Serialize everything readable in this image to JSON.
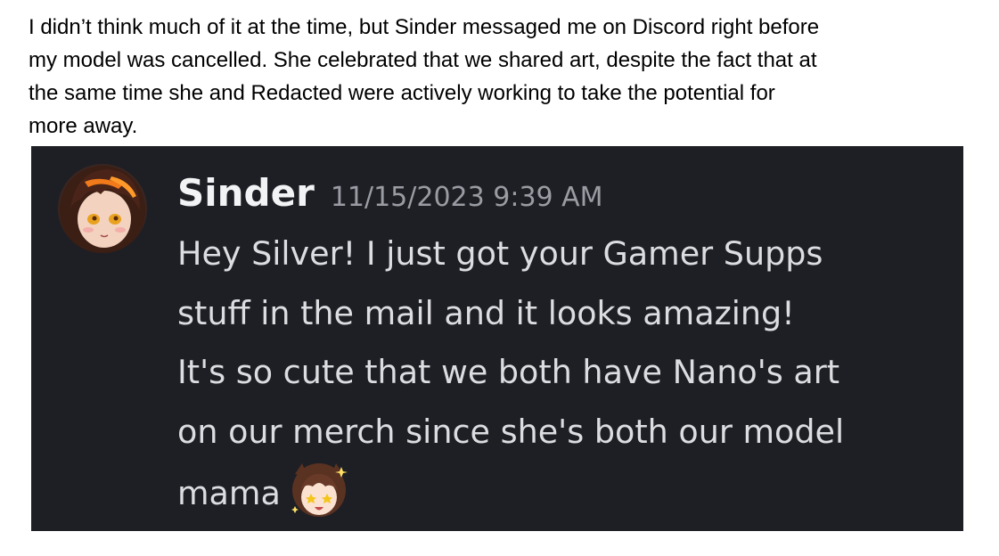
{
  "intro": {
    "lines": [
      "I didn’t think much of it at the time, but Sinder messaged me on Discord right before",
      "my model was cancelled. She celebrated that we shared art, despite the fact that at",
      "the same time she and Redacted were actively working to take the potential for",
      "more away."
    ]
  },
  "message": {
    "username": "Sinder",
    "timestamp": "11/15/2023 9:39 AM",
    "lines": [
      "Hey Silver! I just got your Gamer Supps",
      "stuff in the mail and it looks amazing!",
      "It's so cute that we both have Nano's art",
      "on our merch since she's both our model",
      "mama"
    ],
    "avatar_icon": "anime-girl-avatar",
    "emoji_icon": "star-eyes-anime-emoji"
  },
  "colors": {
    "card_background": "#1e1f24",
    "username": "#f2f3f5",
    "timestamp": "#9a9ca4",
    "message_text": "#dcdde1"
  }
}
